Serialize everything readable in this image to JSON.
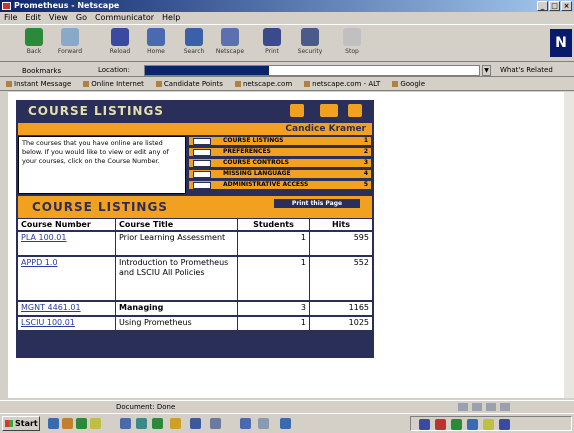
{
  "window": {
    "title": "Prometheus - Netscape"
  },
  "menu": [
    "File",
    "Edit",
    "View",
    "Go",
    "Communicator",
    "Help"
  ],
  "toolbar": {
    "buttons": [
      {
        "label": "Back",
        "icon": "back-icon",
        "color": "#2a8a3a"
      },
      {
        "label": "Forward",
        "icon": "forward-icon",
        "color": "#8aa8c8"
      },
      {
        "label": "Reload",
        "icon": "reload-icon",
        "color": "#3a4aa0"
      },
      {
        "label": "Home",
        "icon": "home-icon",
        "color": "#4a6ab0"
      },
      {
        "label": "Search",
        "icon": "search-icon",
        "color": "#3a60a8"
      },
      {
        "label": "Netscape",
        "icon": "netscape-icon",
        "color": "#5a70b0"
      },
      {
        "label": "Print",
        "icon": "print-icon",
        "color": "#3a4a8a"
      },
      {
        "label": "Security",
        "icon": "security-icon",
        "color": "#4a5a8a"
      },
      {
        "label": "Stop",
        "icon": "stop-icon",
        "color": "#c0c0c0"
      }
    ]
  },
  "location": {
    "bookmarks_label": "Bookmarks",
    "location_label": "Location:",
    "related_label": "What's Related"
  },
  "personal_toolbar": [
    "Instant Message",
    "Online Internet",
    "Candidate Points",
    "netscape.com",
    "netscape.com - ALT",
    "Google"
  ],
  "page": {
    "title": "COURSE LISTINGS",
    "user_name": "Candice Kramer",
    "intro": "The courses that you have online are listed below. If you would like to view or edit any of your courses, click on the Course Number.",
    "links": [
      {
        "label": "COURSE LISTINGS",
        "num": "1"
      },
      {
        "label": "PREFERENCES",
        "num": "2"
      },
      {
        "label": "COURSE CONTROLS",
        "num": "3"
      },
      {
        "label": "MISSING LANGUAGE",
        "num": "4"
      },
      {
        "label": "ADMINISTRATIVE ACCESS",
        "num": "5"
      }
    ],
    "list_title": "COURSE LISTINGS",
    "print_button": "Print this Page",
    "table": {
      "headers": [
        "Course Number",
        "Course Title",
        "Students",
        "Hits"
      ],
      "rows": [
        {
          "number": "PLA 100.01",
          "title": "Prior Learning Assessment",
          "students": "1",
          "hits": "595"
        },
        {
          "number": "APPD 1.0",
          "title": "Introduction to Prometheus and LSCIU All Policies",
          "students": "1",
          "hits": "552"
        },
        {
          "number": "MGNT 4461.01",
          "title": "Managing",
          "students": "3",
          "hits": "1165"
        },
        {
          "number": "LSCIU 100.01",
          "title": "Using Prometheus",
          "students": "1",
          "hits": "1025"
        }
      ]
    }
  },
  "status": {
    "text": "Document: Done"
  },
  "taskbar": {
    "start_label": "Start"
  }
}
